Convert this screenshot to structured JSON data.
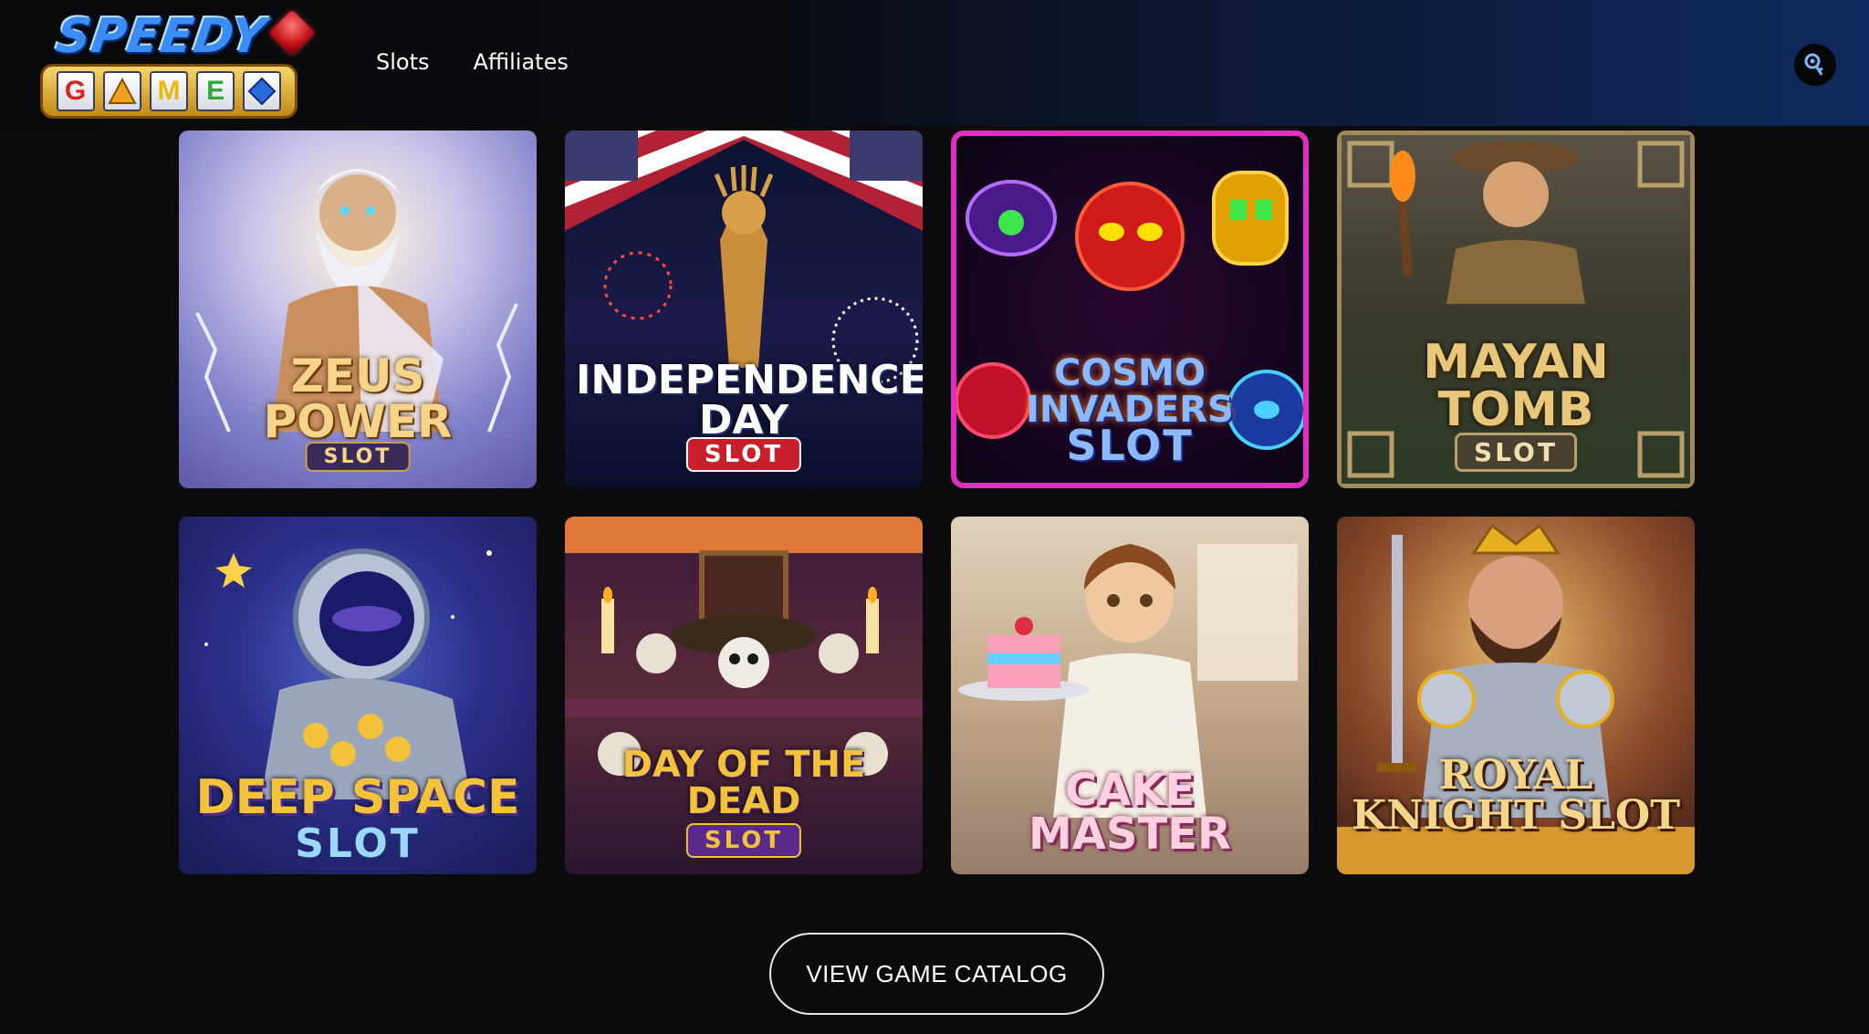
{
  "header": {
    "logo": {
      "word_top": "SPEEDY",
      "word_bottom": "GAMES"
    },
    "nav": [
      {
        "label": "Slots"
      },
      {
        "label": "Affiliates"
      }
    ],
    "key_icon": "key-icon"
  },
  "games": [
    {
      "title": "ZEUS POWER",
      "sub": "SLOT"
    },
    {
      "title": "INDEPENDENCE DAY",
      "sub": "SLOT"
    },
    {
      "title": "COSMO INVADERS",
      "sub": "SLOT"
    },
    {
      "title": "MAYAN TOMB",
      "sub": "SLOT"
    },
    {
      "title": "DEEP SPACE",
      "sub": "SLOT"
    },
    {
      "title": "DAY OF THE DEAD",
      "sub": "SLOT"
    },
    {
      "title": "CAKE MASTER",
      "sub": ""
    },
    {
      "title": "ROYAL KNIGHT SLOT",
      "sub": ""
    }
  ],
  "catalog_button": {
    "label": "VIEW GAME CATALOG"
  },
  "colors": {
    "background": "#0b0b0d",
    "header_accent": "#0e2a5c",
    "button_border": "#e8e8e8"
  }
}
